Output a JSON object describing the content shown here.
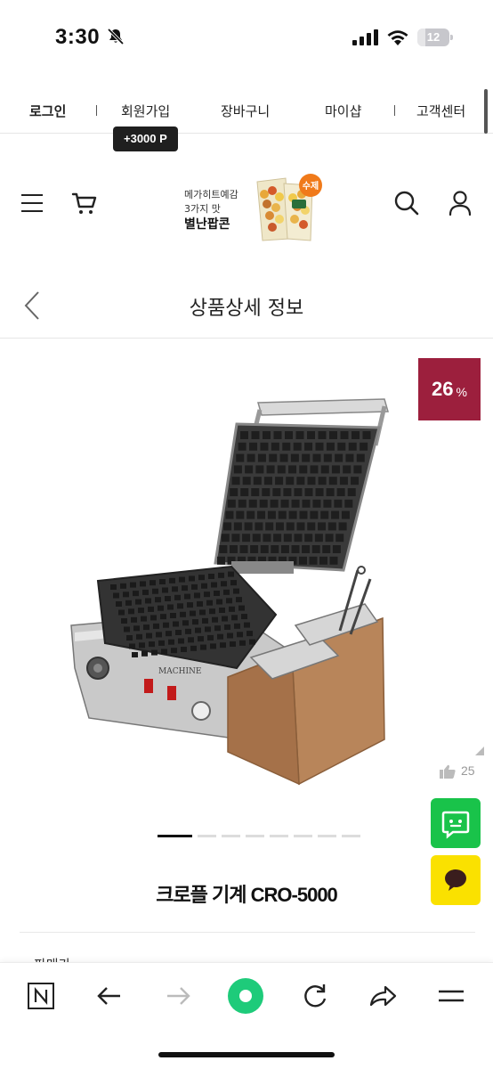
{
  "status_bar": {
    "time": "3:30",
    "battery": "12"
  },
  "top_nav": {
    "items": [
      {
        "label": "로그인"
      },
      {
        "label": "회원가입"
      },
      {
        "label": "장바구니"
      },
      {
        "label": "마이샵"
      },
      {
        "label": "고객센터"
      }
    ],
    "points_badge": "+3000 P"
  },
  "header": {
    "banner": {
      "line1": "메가히트예감",
      "line2": "3가지 맛",
      "line3": "별난팝콘",
      "sticker": "수제"
    },
    "icons": [
      "hamburger-icon",
      "cart-icon",
      "search-icon",
      "user-icon"
    ]
  },
  "page": {
    "title": "상품상세 정보"
  },
  "product": {
    "discount_value": "26",
    "discount_unit": "%",
    "name": "크로플 기계 CRO-5000",
    "image_text": "MACHINE",
    "slides_total": 8,
    "slide_active": 1
  },
  "floating": {
    "like_count": "25"
  },
  "next_section_label": "판매가",
  "browser_bar": {
    "icons": [
      "n-logo-icon",
      "back-arrow-icon",
      "forward-arrow-icon",
      "green-home-icon",
      "reload-icon",
      "share-icon",
      "menu-icon"
    ]
  },
  "colors": {
    "discount_bg": "#9c1f3d",
    "talk_green": "#19c34a",
    "kakao_yellow": "#fae100",
    "browser_green": "#1ecb7a"
  }
}
